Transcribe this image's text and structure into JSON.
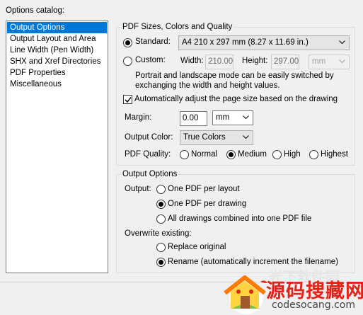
{
  "catalog": {
    "label": "Options catalog:",
    "items": [
      {
        "label": "Output Options",
        "selected": true
      },
      {
        "label": "Output Layout and Area"
      },
      {
        "label": "Line Width (Pen Width)"
      },
      {
        "label": "SHX and Xref Directories"
      },
      {
        "label": "PDF Properties"
      },
      {
        "label": "Miscellaneous"
      }
    ]
  },
  "pdf_group": {
    "title": "PDF Sizes, Colors and Quality",
    "standard_label": "Standard:",
    "standard_value": "A4 210 x 297 mm (8.27 x 11.69 in.)",
    "custom_label": "Custom:",
    "width_label": "Width:",
    "width_value": "210.00",
    "height_label": "Height:",
    "height_value": "297.00",
    "unit_value": "mm",
    "note": "Portrait and landscape mode can be easily switched by exchanging the width and height values.",
    "auto_adjust_label": "Automatically adjust the page size based on the drawing",
    "margin_label": "Margin:",
    "margin_value": "0.00",
    "margin_unit": "mm",
    "output_color_label": "Output Color:",
    "output_color_value": "True Colors",
    "quality_label": "PDF Quality:",
    "quality_options": [
      "Normal",
      "Medium",
      "High",
      "Highest"
    ],
    "quality_selected": "Medium"
  },
  "output_group": {
    "title": "Output Options",
    "output_label": "Output:",
    "output_options": [
      "One PDF per layout",
      "One PDF per drawing",
      "All drawings combined into one PDF file"
    ],
    "output_selected": "One PDF per drawing",
    "overwrite_label": "Overwrite existing:",
    "overwrite_options": [
      "Replace original",
      "Rename (automatically increment the filename)"
    ],
    "overwrite_selected": "Rename (automatically increment the filename)"
  },
  "watermark": {
    "title": "源码搜藏网",
    "url": "codesocang.com",
    "faded": "光下软件园"
  }
}
